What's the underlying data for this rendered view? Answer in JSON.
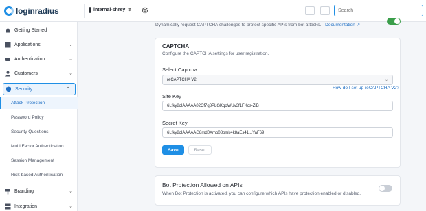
{
  "brand": {
    "logo_text": "loginradius",
    "accent": "#1f8fe5"
  },
  "topbar": {
    "app_name": "internal-shrey",
    "search_placeholder": "Search"
  },
  "sidebar": {
    "items": [
      {
        "label": "Getting Started",
        "icon": "rocket-icon"
      },
      {
        "label": "Applications",
        "icon": "grid-icon"
      },
      {
        "label": "Authentication",
        "icon": "key-icon"
      },
      {
        "label": "Customers",
        "icon": "user-icon"
      },
      {
        "label": "Security",
        "icon": "shield-icon"
      },
      {
        "label": "Branding",
        "icon": "palette-icon"
      },
      {
        "label": "Integration",
        "icon": "puzzle-icon"
      }
    ],
    "security_sub": [
      "Attack Protection",
      "Password Policy",
      "Security Questions",
      "Multi Factor Authentication",
      "Session Management",
      "Risk-based Authentication"
    ]
  },
  "main": {
    "intro": "Dynamically request CAPTCHA challenges to protect specific APIs from bot attacks.",
    "doc_link": "Documentation",
    "captcha_card": {
      "title": "CAPTCHA",
      "subtitle": "Configure the CAPTCHA settings for user registration.",
      "select_label": "Select Captcha",
      "select_value": "reCAPTCHA V2",
      "help_link": "How do I set up reCAPTCHA V2?",
      "site_key_label": "Site Key",
      "site_key_value": "6Lfky8cIAAAAA02Cf7q8PLGKqoWUv3f1FKcs-ZiB",
      "secret_key_label": "Secret Key",
      "secret_key_value": "6Lfky8cIAAAAAG8md0Xmo08bmk4k8aEs41...YaF69",
      "save_label": "Save",
      "reset_label": "Reset"
    },
    "bot_card": {
      "title": "Bot Protection Allowed on APIs",
      "subtitle": "When Bot Protection is activated, you can configure which APIs have protection enabled or disabled."
    }
  }
}
